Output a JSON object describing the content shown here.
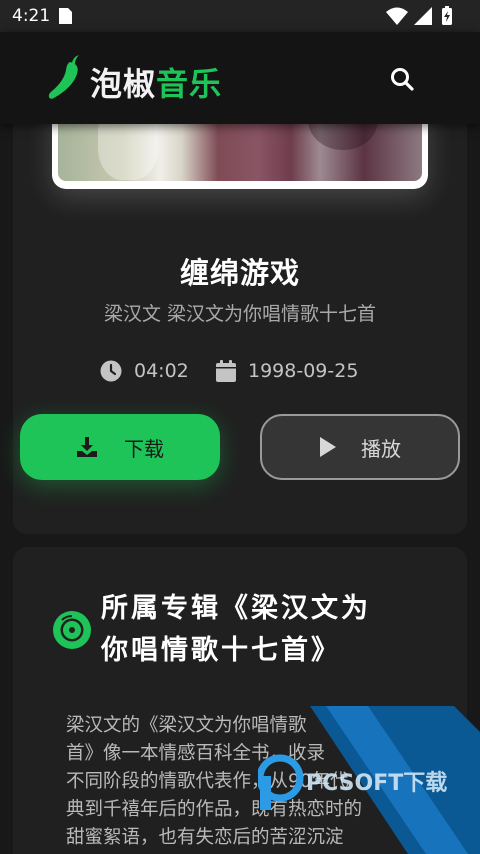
{
  "status_bar": {
    "time": "4:21"
  },
  "app": {
    "brand_part1": "泡椒",
    "brand_part2": "音乐"
  },
  "song": {
    "title": "缠绵游戏",
    "subtitle": "梁汉文 梁汉文为你唱情歌十七首",
    "duration": "04:02",
    "release_date": "1998-09-25"
  },
  "actions": {
    "download_label": "下载",
    "play_label": "播放"
  },
  "album": {
    "title_line1": "所属专辑《梁汉文为",
    "title_line2": "你唱情歌十七首》",
    "description_lines": [
      "梁汉文的《梁汉文为你唱情歌",
      "首》像一本情感百科全书，收录",
      "不同阶段的情歌代表作，从90年代",
      "典到千禧年后的作品，既有热恋时的",
      "甜蜜絮语，也有失恋后的苦涩沉淀"
    ]
  },
  "watermark": {
    "text": "PCSOFT下载"
  },
  "colors": {
    "accent": "#1ec457",
    "background": "#181818",
    "card": "#202020"
  },
  "icons": [
    "sim-icon",
    "wifi-icon",
    "signal-icon",
    "battery-icon",
    "chili-logo-icon",
    "search-icon",
    "clock-icon",
    "calendar-icon",
    "download-icon",
    "play-icon",
    "disc-icon"
  ]
}
